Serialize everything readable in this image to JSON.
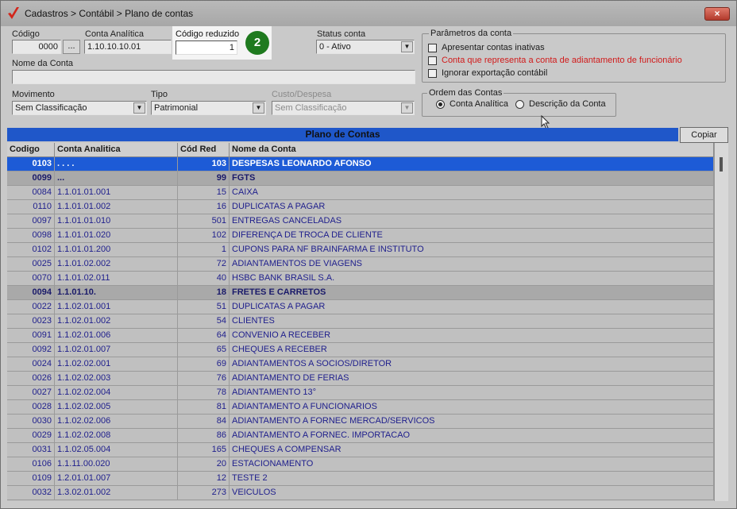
{
  "window": {
    "title": "Cadastros > Contábil > Plano de contas",
    "close_label": "×"
  },
  "form": {
    "codigo_label": "Código",
    "codigo_value": "0000",
    "ellipsis_label": "...",
    "conta_analitica_label": "Conta Analítica",
    "conta_analitica_value": "1.10.10.10.01",
    "codigo_reduzido_label": "Código reduzido",
    "codigo_reduzido_value": "1",
    "step_badge": "2",
    "status_label": "Status conta",
    "status_value": "0 - Ativo",
    "nome_label": "Nome da Conta",
    "nome_value": "",
    "movimento_label": "Movimento",
    "movimento_value": "Sem Classificação",
    "tipo_label": "Tipo",
    "tipo_value": "Patrimonial",
    "custo_label": "Custo/Despesa",
    "custo_value": "Sem Classificação"
  },
  "parametros": {
    "title": "Parâmetros da conta",
    "options": [
      {
        "label": "Apresentar contas inativas",
        "checked": false,
        "color": "#1a1a1a"
      },
      {
        "label": "Conta que representa a conta de adiantamento de funcionário",
        "checked": false,
        "color": "#d11a1a"
      },
      {
        "label": "Ignorar exportação contábil",
        "checked": false,
        "color": "#1a1a1a"
      }
    ]
  },
  "ordem": {
    "title": "Ordem das Contas",
    "options": [
      {
        "label": "Conta Analítica",
        "selected": true
      },
      {
        "label": "Descrição da Conta",
        "selected": false
      }
    ]
  },
  "grid": {
    "title": "Plano de Contas",
    "copy_label": "Copiar",
    "columns": [
      "Codigo",
      "Conta Analitica",
      "Cód Red",
      "Nome da Conta"
    ],
    "rows": [
      {
        "codigo": "0103",
        "conta": ". . . .",
        "red": "103",
        "nome": "DESPESAS LEONARDO AFONSO",
        "style": "selected"
      },
      {
        "codigo": "0099",
        "conta": "...",
        "red": "99",
        "nome": "FGTS",
        "style": "bold"
      },
      {
        "codigo": "0084",
        "conta": "1.1.01.01.001",
        "red": "15",
        "nome": "CAIXA",
        "style": ""
      },
      {
        "codigo": "0110",
        "conta": "1.1.01.01.002",
        "red": "16",
        "nome": "DUPLICATAS A PAGAR",
        "style": ""
      },
      {
        "codigo": "0097",
        "conta": "1.1.01.01.010",
        "red": "501",
        "nome": "ENTREGAS CANCELADAS",
        "style": ""
      },
      {
        "codigo": "0098",
        "conta": "1.1.01.01.020",
        "red": "102",
        "nome": "DIFERENÇA DE TROCA DE CLIENTE",
        "style": ""
      },
      {
        "codigo": "0102",
        "conta": "1.1.01.01.200",
        "red": "1",
        "nome": "CUPONS PARA NF BRAINFARMA E INSTITUTO",
        "style": ""
      },
      {
        "codigo": "0025",
        "conta": "1.1.01.02.002",
        "red": "72",
        "nome": "ADIANTAMENTOS DE VIAGENS",
        "style": ""
      },
      {
        "codigo": "0070",
        "conta": "1.1.01.02.011",
        "red": "40",
        "nome": "HSBC BANK BRASIL S.A.",
        "style": ""
      },
      {
        "codigo": "0094",
        "conta": "1.1.01.10.",
        "red": "18",
        "nome": "FRETES E CARRETOS",
        "style": "bold"
      },
      {
        "codigo": "0022",
        "conta": "1.1.02.01.001",
        "red": "51",
        "nome": "DUPLICATAS A PAGAR",
        "style": ""
      },
      {
        "codigo": "0023",
        "conta": "1.1.02.01.002",
        "red": "54",
        "nome": "CLIENTES",
        "style": ""
      },
      {
        "codigo": "0091",
        "conta": "1.1.02.01.006",
        "red": "64",
        "nome": "CONVENIO A RECEBER",
        "style": ""
      },
      {
        "codigo": "0092",
        "conta": "1.1.02.01.007",
        "red": "65",
        "nome": "CHEQUES A RECEBER",
        "style": ""
      },
      {
        "codigo": "0024",
        "conta": "1.1.02.02.001",
        "red": "69",
        "nome": "ADIANTAMENTOS A SOCIOS/DIRETOR",
        "style": ""
      },
      {
        "codigo": "0026",
        "conta": "1.1.02.02.003",
        "red": "76",
        "nome": "ADIANTAMENTO DE FERIAS",
        "style": ""
      },
      {
        "codigo": "0027",
        "conta": "1.1.02.02.004",
        "red": "78",
        "nome": "ADIANTAMENTO 13°",
        "style": ""
      },
      {
        "codigo": "0028",
        "conta": "1.1.02.02.005",
        "red": "81",
        "nome": "ADIANTAMENTO A FUNCIONARIOS",
        "style": ""
      },
      {
        "codigo": "0030",
        "conta": "1.1.02.02.006",
        "red": "84",
        "nome": "ADIANTAMENTO A FORNEC MERCAD/SERVICOS",
        "style": ""
      },
      {
        "codigo": "0029",
        "conta": "1.1.02.02.008",
        "red": "86",
        "nome": "ADIANTAMENTO A FORNEC. IMPORTACAO",
        "style": ""
      },
      {
        "codigo": "0031",
        "conta": "1.1.02.05.004",
        "red": "165",
        "nome": "CHEQUES A COMPENSAR",
        "style": ""
      },
      {
        "codigo": "0106",
        "conta": "1.1.11.00.020",
        "red": "20",
        "nome": "ESTACIONAMENTO",
        "style": ""
      },
      {
        "codigo": "0109",
        "conta": "1.2.01.01.007",
        "red": "12",
        "nome": "TESTE 2",
        "style": ""
      },
      {
        "codigo": "0032",
        "conta": "1.3.02.01.002",
        "red": "273",
        "nome": "VEICULOS",
        "style": ""
      }
    ]
  }
}
